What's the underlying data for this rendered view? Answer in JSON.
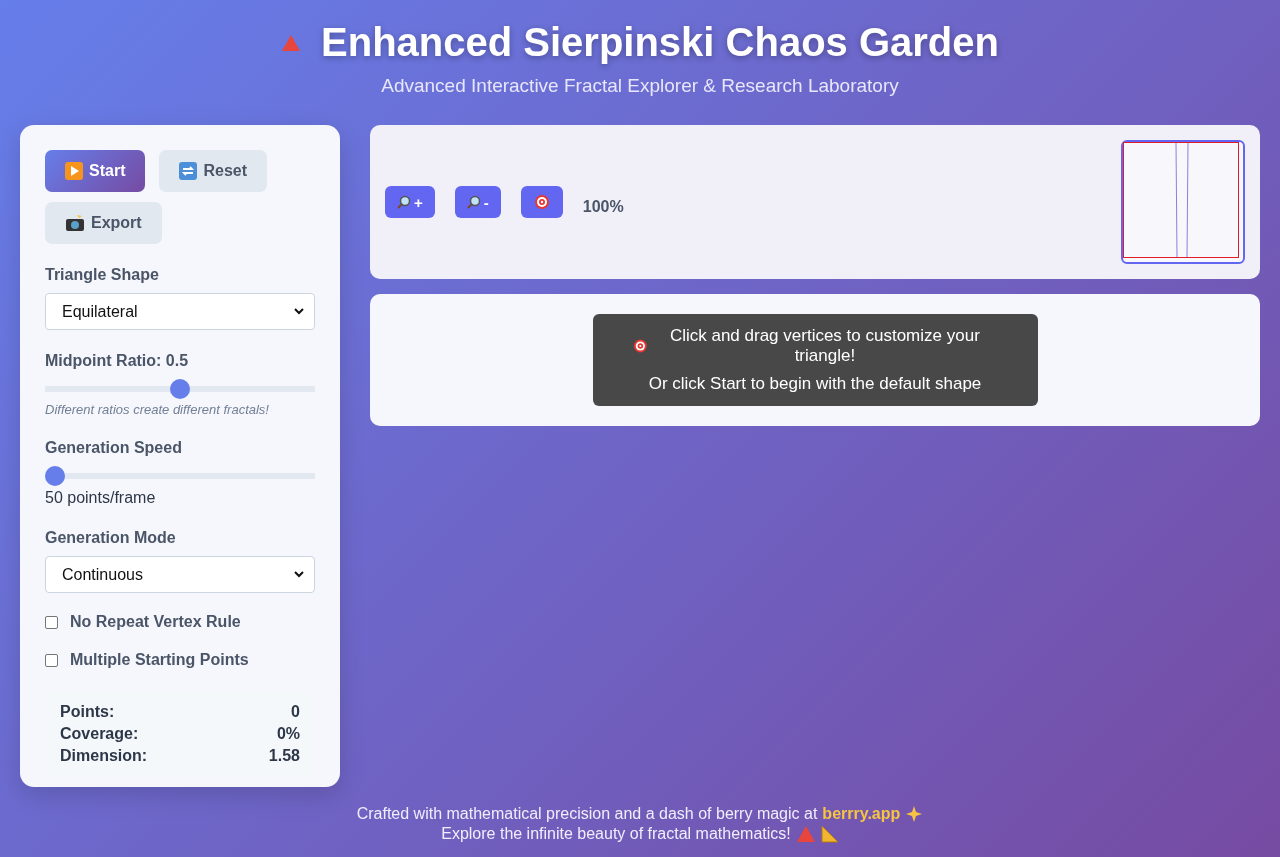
{
  "header": {
    "title": "Enhanced Sierpinski Chaos Garden",
    "subtitle": "Advanced Interactive Fractal Explorer & Research Laboratory"
  },
  "controls": {
    "buttons": [
      {
        "label": "Start",
        "kind": "play",
        "primary": true
      },
      {
        "label": "Reset",
        "kind": "reset",
        "primary": false
      },
      {
        "label": "Export",
        "kind": "camera",
        "primary": false
      }
    ],
    "fields": [
      {
        "kind": "select",
        "label": "Triangle Shape",
        "value": "Equilateral"
      },
      {
        "kind": "slider",
        "label": "Midpoint Ratio: 0.5",
        "level": 0.5,
        "hint": "Different ratios create different fractals!"
      },
      {
        "kind": "slider",
        "label": "Generation Speed",
        "level": 0.0,
        "reading": "50 points/frame"
      },
      {
        "kind": "select",
        "label": "Generation Mode",
        "value": "Continuous"
      },
      {
        "kind": "checkbox",
        "label": "No Repeat Vertex Rule",
        "checked": false
      },
      {
        "kind": "checkbox",
        "label": "Multiple Starting Points",
        "checked": false
      }
    ],
    "stats": [
      {
        "label": "Points:",
        "value": "0"
      },
      {
        "label": "Coverage:",
        "value": "0%"
      },
      {
        "label": "Dimension:",
        "value": "1.58"
      }
    ]
  },
  "toolbar": {
    "buttons": [
      {
        "label": "+",
        "kind": "zoom-in"
      },
      {
        "label": "-",
        "kind": "zoom-out"
      },
      {
        "kind": "target"
      }
    ],
    "zoom": "100%"
  },
  "canvas": {
    "overlay": [
      "Click and drag vertices to customize your triangle!",
      "Or click Start to begin with the default shape"
    ]
  },
  "footer": {
    "line1": "Crafted with mathematical precision and a dash of berry magic at",
    "link": "berrry.app",
    "line2": "Explore the infinite beauty of fractal mathematics!"
  }
}
